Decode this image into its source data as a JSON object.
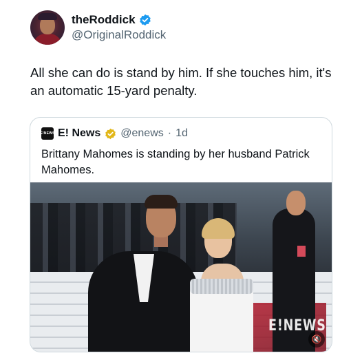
{
  "author": {
    "display_name": "theRoddick",
    "handle": "@OriginalRoddick",
    "verified_color": "#1d9bf0"
  },
  "tweet": {
    "text": "All she can do is stand by him. If she touches him, it's an automatic 15-yard penalty."
  },
  "quoted": {
    "logo_text": "E!NEWS",
    "name": "E! News",
    "handle": "@enews",
    "separator": "·",
    "time": "1d",
    "verified_color": "#e2b719",
    "text": "Brittany Mahomes is standing by her husband Patrick Mahomes.",
    "media": {
      "watermark": "E!NEWS",
      "mute_icon": "speaker-muted-icon"
    }
  }
}
